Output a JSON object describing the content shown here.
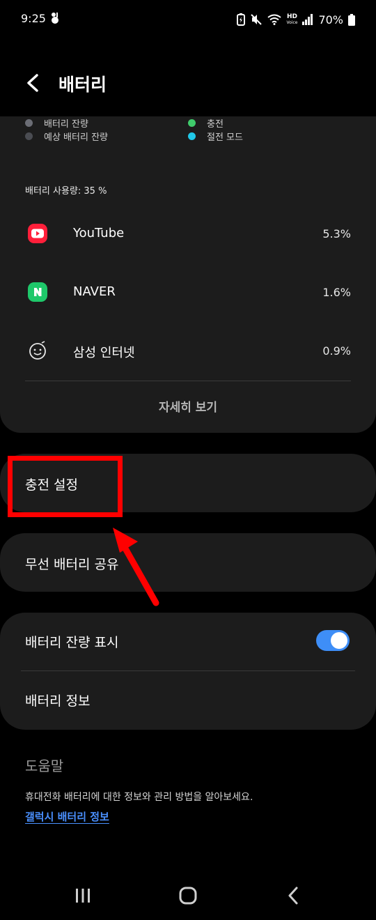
{
  "status_bar": {
    "time": "9:25",
    "hd_label": "HD",
    "hd_sublabel": "Voice",
    "battery_text": "70%"
  },
  "header": {
    "title": "배터리",
    "back_icon": "chevron-left-icon"
  },
  "legend": [
    {
      "label": "배터리 잔량",
      "color": "#6b6d75"
    },
    {
      "label": "예상 배터리 잔량",
      "color": "#4a4c52"
    },
    {
      "label": "충전",
      "color": "#3fcb6b"
    },
    {
      "label": "절전 모드",
      "color": "#20c8e8"
    }
  ],
  "usage": {
    "title": "배터리 사용량: 35 %",
    "apps": [
      {
        "name": "YouTube",
        "value": "5.3%",
        "icon": "youtube-icon"
      },
      {
        "name": "NAVER",
        "value": "1.6%",
        "icon": "naver-icon"
      },
      {
        "name": "삼성 인터넷",
        "value": "0.9%",
        "icon": "samsung-internet-icon"
      }
    ],
    "details_label": "자세히 보기"
  },
  "settings": {
    "charging": "충전 설정",
    "wireless_share": "무선 배터리 공유",
    "show_percentage": "배터리 잔량 표시",
    "show_percentage_on": true,
    "battery_info": "배터리 정보"
  },
  "help": {
    "title": "도움말",
    "description": "휴대전화 배터리에 대한 정보와 관리 방법을 알아보세요.",
    "link": "갤럭시 배터리 정보"
  },
  "colors": {
    "highlight": "#ff0000",
    "toggle_on": "#3e8ef7",
    "link": "#4a90ff"
  }
}
